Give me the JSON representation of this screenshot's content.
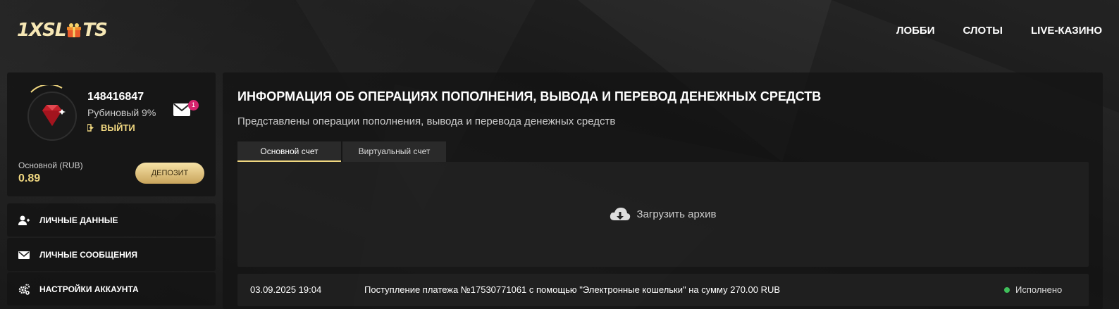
{
  "brand": {
    "logo_left": "1X",
    "logo_right": "SL",
    "logo_end": "TS"
  },
  "nav": {
    "items": [
      "ЛОББИ",
      "СЛОТЫ",
      "LIVE-КАЗИНО"
    ]
  },
  "profile": {
    "user_id": "148416847",
    "level": "Рубиновый 9%",
    "logout_label": "ВЫЙТИ",
    "messages_count": "1",
    "balance_label": "Основной (RUB)",
    "balance_value": "0.89",
    "deposit_label": "ДЕПОЗИТ"
  },
  "sidebar": {
    "items": [
      {
        "label": "ЛИЧНЫЕ ДАННЫЕ",
        "icon": "user-add-icon"
      },
      {
        "label": "ЛИЧНЫЕ СООБЩЕНИЯ",
        "icon": "envelope-icon"
      },
      {
        "label": "НАСТРОЙКИ АККАУНТА",
        "icon": "gears-icon"
      }
    ]
  },
  "main": {
    "title": "ИНФОРМАЦИЯ ОБ ОПЕРАЦИЯХ ПОПОЛНЕНИЯ, ВЫВОДА И ПЕРЕВОД ДЕНЕЖНЫХ СРЕДСТВ",
    "subtitle": "Представлены операции пополнения, вывода и перевода денежных средств",
    "tabs": [
      {
        "label": "Основной счет",
        "active": true
      },
      {
        "label": "Виртуальный счет",
        "active": false
      }
    ],
    "archive_label": "Загрузить архив",
    "operations": [
      {
        "date": "03.09.2025 19:04",
        "description": "Поступление платежа №17530771061 с помощью \"Электронные кошельки\" на сумму 270.00 RUB",
        "status": "Исполнено"
      }
    ]
  },
  "colors": {
    "accent_gold": "#f0d780",
    "status_success": "#3fbf5a",
    "badge": "#d6246e"
  }
}
